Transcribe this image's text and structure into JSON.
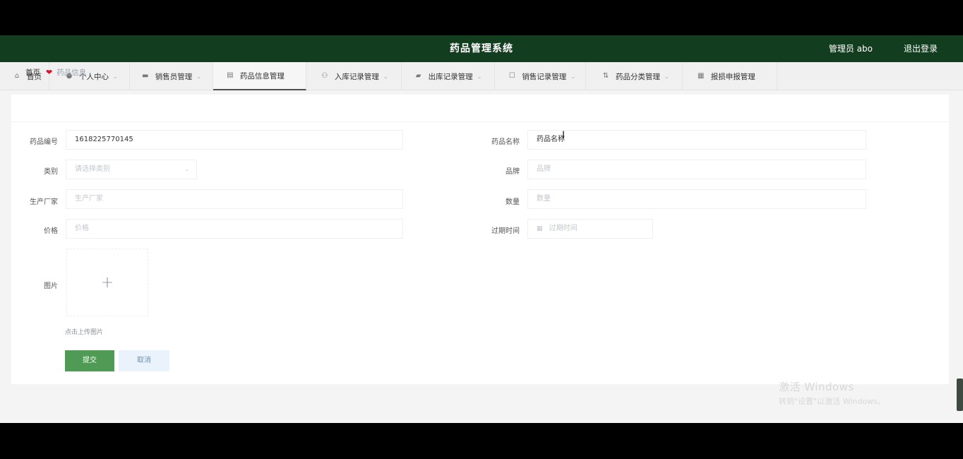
{
  "header": {
    "title": "药品管理系统",
    "user": "管理员 abo",
    "logout": "退出登录"
  },
  "nav": {
    "items": [
      {
        "label": "首页",
        "icon": "home-icon",
        "has_dropdown": false
      },
      {
        "label": "个人中心",
        "icon": "user-icon",
        "has_dropdown": true
      },
      {
        "label": "销售员管理",
        "icon": "monitor-icon",
        "has_dropdown": true
      },
      {
        "label": "药品信息管理",
        "icon": "pill-icon",
        "has_dropdown": false,
        "active": true
      },
      {
        "label": "入库记录管理",
        "icon": "inbox-icon",
        "has_dropdown": true
      },
      {
        "label": "出库记录管理",
        "icon": "truck-icon",
        "has_dropdown": true
      },
      {
        "label": "销售记录管理",
        "icon": "list-icon",
        "has_dropdown": true
      },
      {
        "label": "药品分类管理",
        "icon": "sort-icon",
        "has_dropdown": true
      },
      {
        "label": "报损申报管理",
        "icon": "report-icon",
        "has_dropdown": false
      }
    ]
  },
  "breadcrumb": {
    "home": "首页",
    "current": "药品信息"
  },
  "form": {
    "code_label": "药品编号",
    "code_value": "1618225770145",
    "name_label": "药品名称",
    "name_value": "药品名称",
    "category_label": "类别",
    "category_placeholder": "请选择类别",
    "brand_label": "品牌",
    "brand_placeholder": "品牌",
    "maker_label": "生产厂家",
    "maker_placeholder": "生产厂家",
    "qty_label": "数量",
    "qty_placeholder": "数量",
    "price_label": "价格",
    "price_placeholder": "价格",
    "expire_label": "过期时间",
    "expire_placeholder": "过期时间",
    "image_label": "图片",
    "upload_hint": "点击上传图片"
  },
  "buttons": {
    "submit": "提交",
    "cancel": "取消"
  },
  "watermark": {
    "line1": "激活 Windows",
    "line2": "转到\"设置\"以激活 Windows。"
  },
  "colors": {
    "header_bg": "#133d1f",
    "submit_bg": "#4f9a55",
    "cancel_bg": "#eaf3fb",
    "heart": "#d9142c"
  }
}
